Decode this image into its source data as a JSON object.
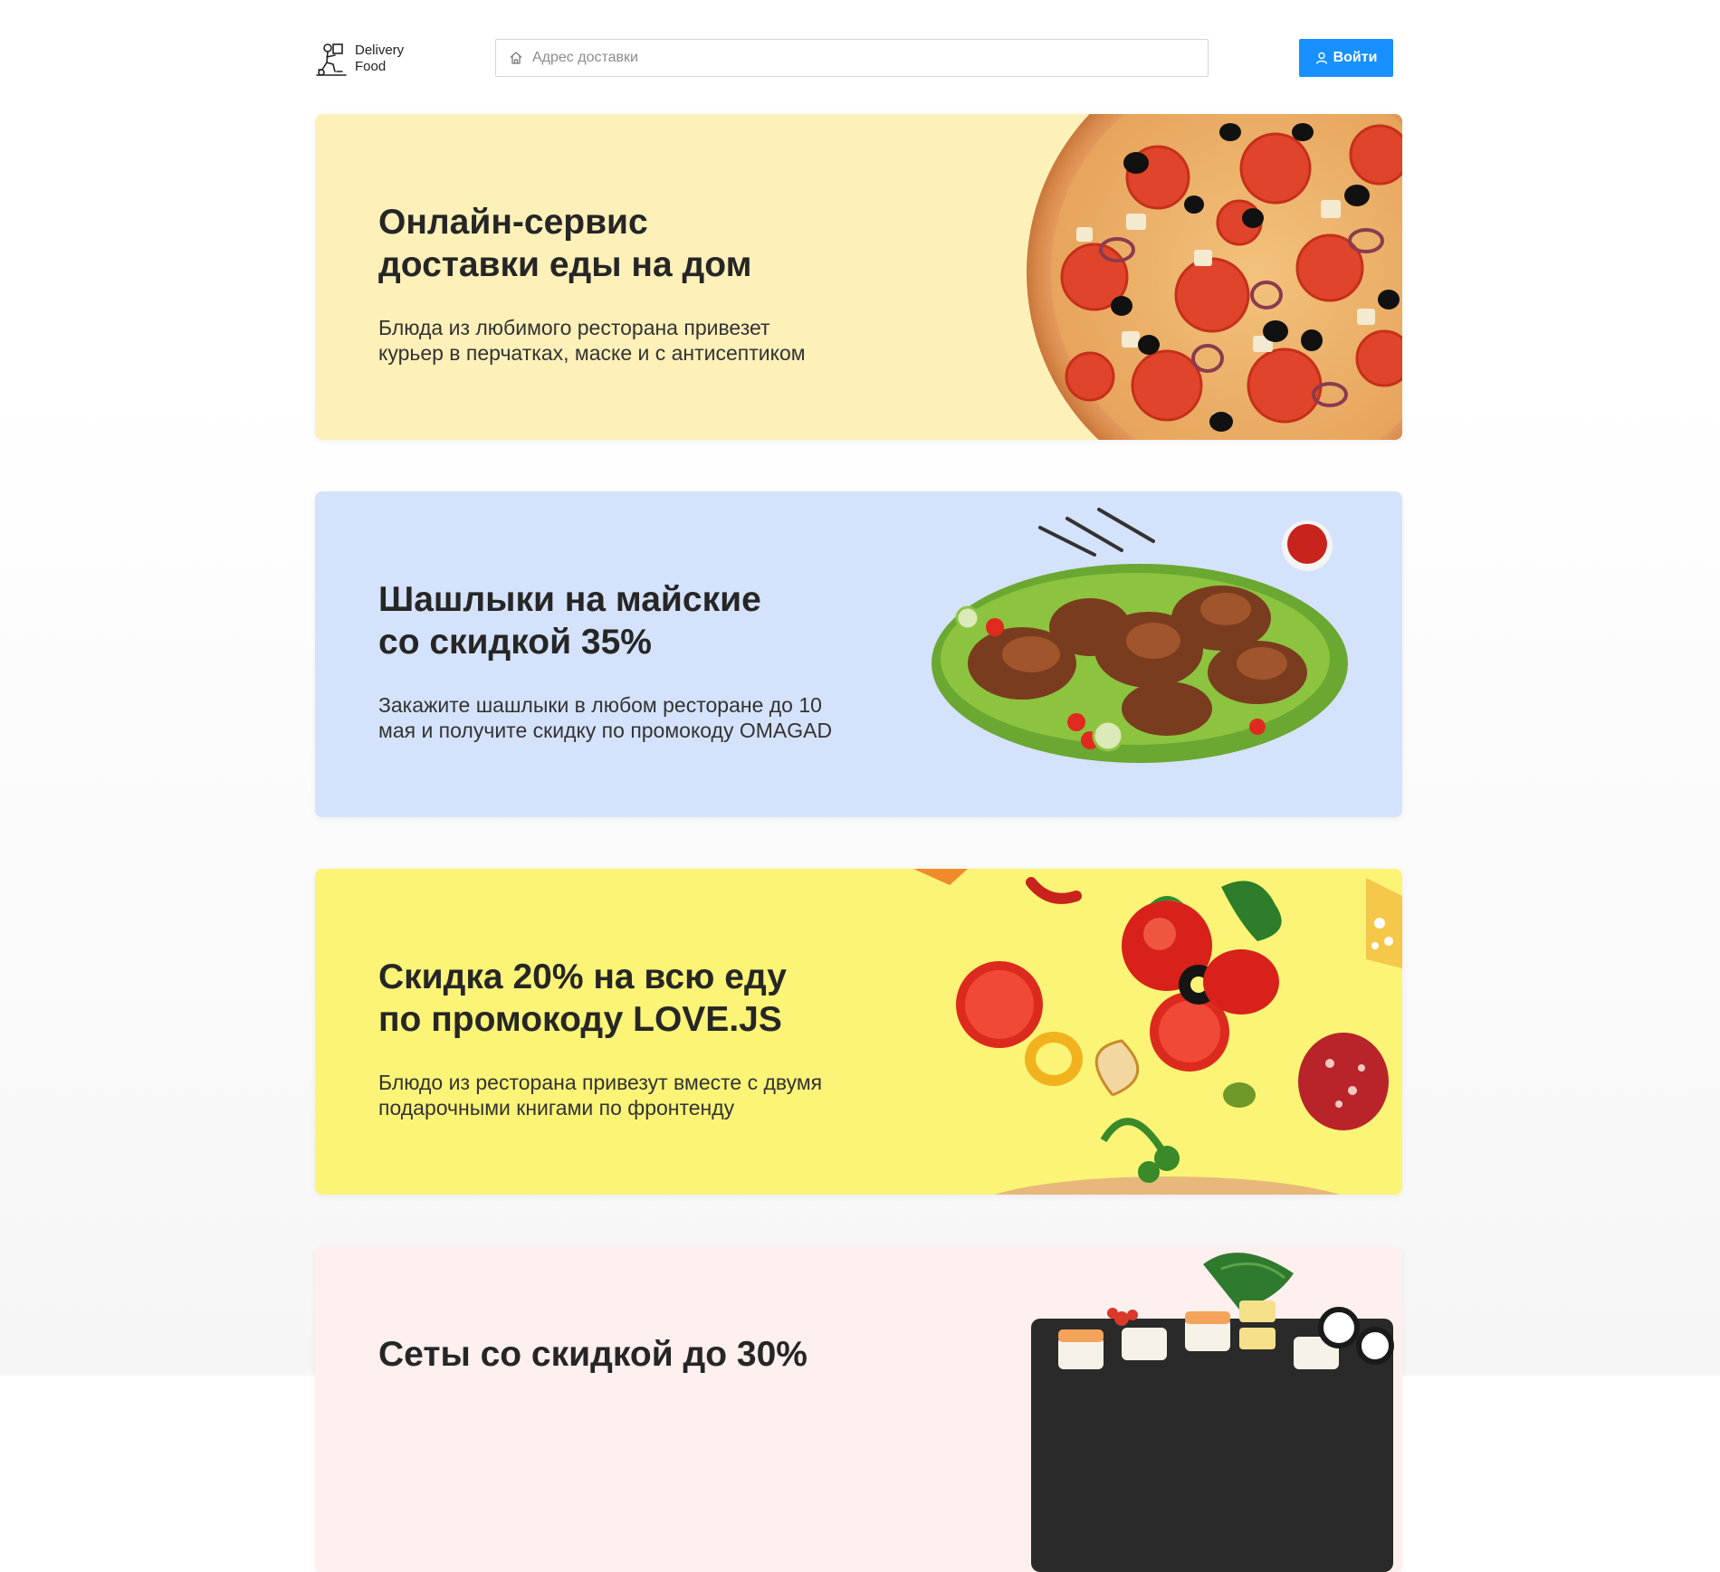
{
  "header": {
    "logo_line1": "Delivery",
    "logo_line2": "Food",
    "address_placeholder": "Адрес доставки",
    "login_label": "Войти",
    "accent": "#1890ff"
  },
  "promos": [
    {
      "title": "Онлайн-сервис\nдоставки еды на дом",
      "description": "Блюда из любимого ресторана привезет\nкурьер в перчатках, маске и с антисептиком",
      "background": "#fdf0b9",
      "image": "pizza-image"
    },
    {
      "title": "Шашлыки на майские\nсо скидкой 35%",
      "description": "Закажите шашлыки в любом ресторане до 10\nмая и получите скидку по промокоду OMAGAD",
      "background": "#d5e2fb",
      "image": "kebab-image"
    },
    {
      "title": "Скидка 20% на всю еду\nпо промокоду LOVE.JS",
      "description": "Блюдо из ресторана привезут вместе с двумя\nподарочными книгами по фронтенду",
      "background": "#fbf477",
      "image": "flying-ingredients-image"
    },
    {
      "title": "Сеты со скидкой до 30%",
      "description": "",
      "background": "#fdf0ee",
      "image": "sushi-image"
    }
  ]
}
